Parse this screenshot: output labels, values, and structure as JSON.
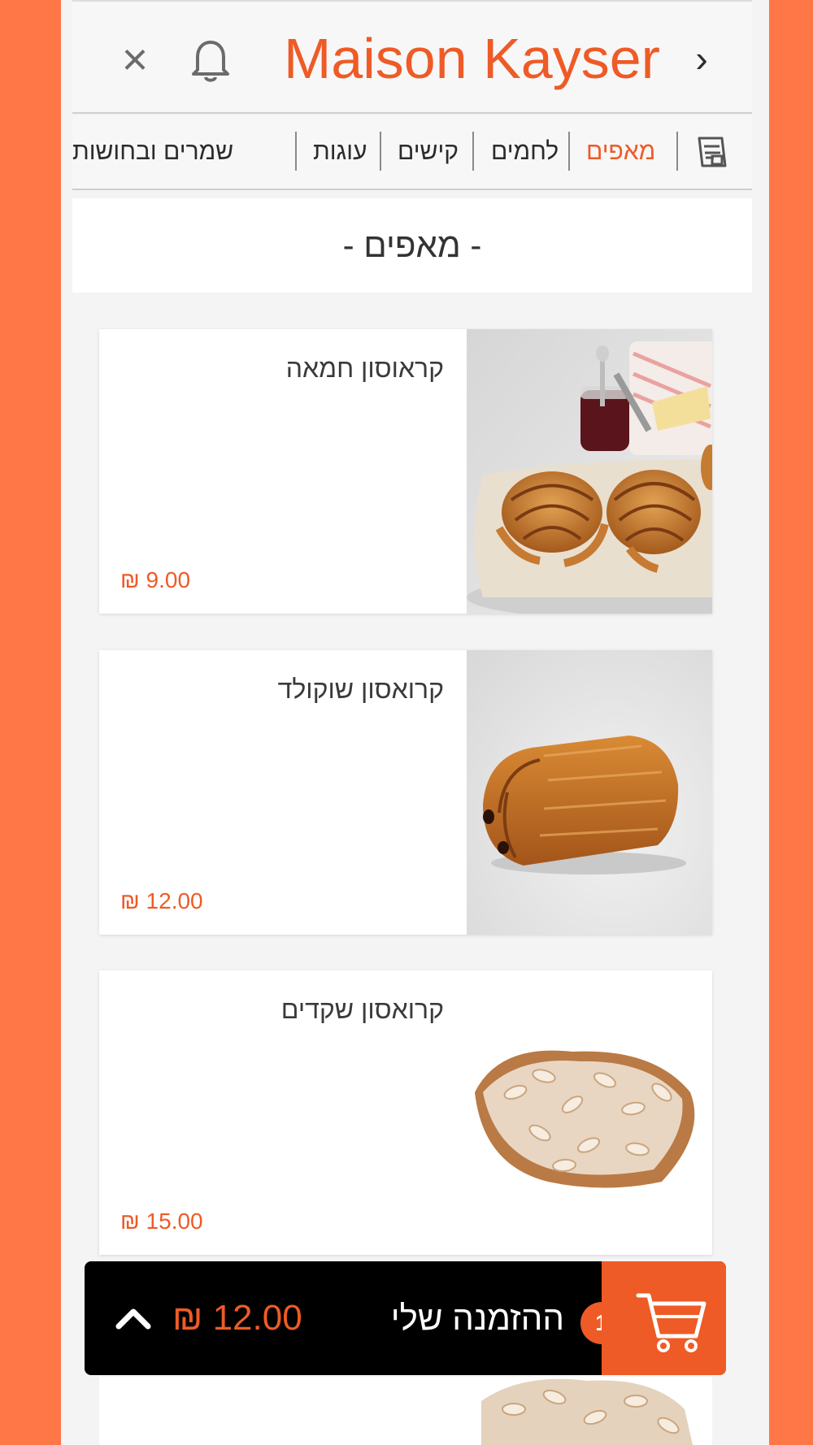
{
  "header": {
    "title": "Maison Kayser",
    "close_glyph": "×",
    "next_glyph": "›",
    "bell_icon": "bell-icon",
    "title_color": "#EE5B26"
  },
  "categories": [
    {
      "label": "מאפים",
      "active": true
    },
    {
      "label": "לחמים",
      "active": false
    },
    {
      "label": "קישים",
      "active": false
    },
    {
      "label": "עוגות",
      "active": false
    },
    {
      "label": "שמרים ובחושות",
      "active": false
    }
  ],
  "section": {
    "title": "- מאפים -"
  },
  "products": [
    {
      "name": "קראוסון חמאה",
      "price": "₪ 9.00",
      "image": "butter-croissant-photo"
    },
    {
      "name": "קרואסון שוקולד",
      "price": "₪ 12.00",
      "image": "chocolate-croissant-photo"
    },
    {
      "name": "קרואסון שקדים",
      "price": "₪ 15.00",
      "image": "almond-croissant-photo"
    }
  ],
  "order_bar": {
    "label": "ההזמנה שלי",
    "total": "₪ 12.00",
    "item_count": "1",
    "cart_icon": "cart-icon",
    "expand_icon": "chevron-up-icon"
  },
  "colors": {
    "accent": "#EE5B26",
    "background": "#FF7647",
    "order_bar": "#000000"
  }
}
